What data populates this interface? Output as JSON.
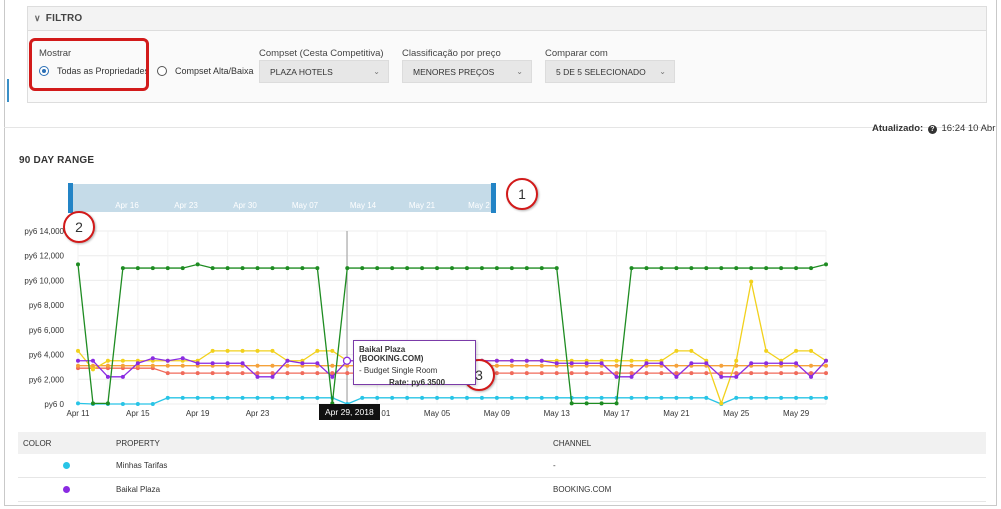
{
  "filter": {
    "title": "FILTRO",
    "show_label": "Mostrar",
    "radio_all": "Todas as Propriedades",
    "radio_compset": "Compset Alta/Baixa",
    "compset_label": "Compset (Cesta Competitiva)",
    "compset_value": "PLAZA HOTELS",
    "price_label": "Classificação por preço",
    "price_value": "MENORES PREÇOS",
    "compare_label": "Comparar com",
    "compare_value": "5 DE 5 SELECIONADO"
  },
  "updated": {
    "label": "Atualizado:",
    "value": "16:24 10 Abr"
  },
  "section_title": "90 DAY RANGE",
  "callouts": [
    "1",
    "2",
    "3"
  ],
  "tooltip": {
    "title": "Baikal Plaza (BOOKING.COM)",
    "room": "- Budget Single Room",
    "rate": "Rate: py6 3500"
  },
  "hover_date": "Apr 29, 2018",
  "colors": {
    "green": "#1e8c22",
    "yellow": "#f2d11c",
    "purple": "#8a2be2",
    "red": "#f06a5a",
    "orange": "#f5a23a",
    "cyan": "#28c4e6",
    "navigator": "#c5dbe8",
    "handle": "#2384c6"
  },
  "chart_data": {
    "type": "line",
    "ylim": [
      0,
      14000
    ],
    "y_ticks": [
      "py6 0",
      "py6 2,000",
      "py6 4,000",
      "py6 6,000",
      "py6 8,000",
      "py6 10,000",
      "py6 12,000",
      "py6 14,000"
    ],
    "x_ticks": [
      "Apr 11",
      "Apr 15",
      "Apr 19",
      "Apr 23",
      "Apr 29",
      "May 01",
      "May 05",
      "May 09",
      "May 13",
      "May 17",
      "May 21",
      "May 25",
      "May 29"
    ],
    "navigator_ticks": [
      "Apr 16",
      "Apr 23",
      "Apr 30",
      "May 07",
      "May 14",
      "May 21",
      "May 2"
    ],
    "x_start": "2018-04-11",
    "num_days": 51,
    "series": [
      {
        "color": "green",
        "values": [
          11300,
          50,
          50,
          11000,
          11000,
          11000,
          11000,
          11000,
          11300,
          11000,
          11000,
          11000,
          11000,
          11000,
          11000,
          11000,
          11000,
          50,
          11000,
          11000,
          11000,
          11000,
          11000,
          11000,
          11000,
          11000,
          11000,
          11000,
          11000,
          11000,
          11000,
          11000,
          11000,
          50,
          50,
          50,
          50,
          11000,
          11000,
          11000,
          11000,
          11000,
          11000,
          11000,
          11000,
          11000,
          11000,
          11000,
          11000,
          11000,
          11300
        ]
      },
      {
        "color": "yellow",
        "values": [
          4300,
          2800,
          3500,
          3500,
          3500,
          3500,
          3500,
          3500,
          3500,
          4300,
          4300,
          4300,
          4300,
          4300,
          3500,
          3500,
          4300,
          4300,
          3500,
          3500,
          3500,
          3500,
          3500,
          3500,
          3500,
          3500,
          3500,
          3500,
          3500,
          3500,
          3500,
          3500,
          3500,
          3500,
          3500,
          3500,
          3500,
          3500,
          3500,
          3500,
          4300,
          4300,
          3500,
          50,
          3500,
          9900,
          4300,
          3500,
          4300,
          4300,
          3500
        ]
      },
      {
        "color": "purple",
        "values": [
          3500,
          3500,
          2200,
          2200,
          3300,
          3700,
          3500,
          3700,
          3300,
          3300,
          3300,
          3300,
          2200,
          2200,
          3500,
          3300,
          3300,
          2200,
          3500,
          3500,
          3500,
          3500,
          3500,
          3500,
          3500,
          3500,
          3500,
          3500,
          3500,
          3500,
          3500,
          3500,
          3300,
          3300,
          3300,
          3300,
          2200,
          2200,
          3300,
          3300,
          2200,
          3300,
          3300,
          2200,
          2200,
          3300,
          3300,
          3300,
          3300,
          2200,
          3500
        ]
      },
      {
        "color": "red",
        "values": [
          2900,
          2900,
          2900,
          2900,
          2900,
          2900,
          2500,
          2500,
          2500,
          2500,
          2500,
          2500,
          2500,
          2500,
          2500,
          2500,
          2500,
          2500,
          2500,
          2500,
          2500,
          2500,
          2500,
          2500,
          2500,
          2500,
          2500,
          2500,
          2500,
          2500,
          2500,
          2500,
          2500,
          2500,
          2500,
          2500,
          2500,
          2500,
          2500,
          2500,
          2500,
          2500,
          2500,
          2500,
          2500,
          2500,
          2500,
          2500,
          2500,
          2500,
          2500
        ]
      },
      {
        "color": "orange",
        "values": [
          3100,
          3100,
          3100,
          3100,
          3100,
          3100,
          3100,
          3100,
          3100,
          3100,
          3100,
          3100,
          3100,
          3100,
          3100,
          3100,
          3100,
          3100,
          3100,
          3100,
          3100,
          3100,
          3100,
          3100,
          3100,
          3100,
          3100,
          3100,
          3100,
          3100,
          3100,
          3100,
          3100,
          3100,
          3100,
          3100,
          3100,
          3100,
          3100,
          3100,
          3100,
          3100,
          3100,
          3100,
          3100,
          3100,
          3100,
          3100,
          3100,
          3100,
          3100
        ]
      },
      {
        "color": "cyan",
        "values": [
          50,
          0,
          0,
          0,
          0,
          0,
          500,
          500,
          500,
          500,
          500,
          500,
          500,
          500,
          500,
          500,
          500,
          500,
          0,
          500,
          500,
          500,
          500,
          500,
          500,
          500,
          500,
          500,
          500,
          500,
          500,
          500,
          500,
          500,
          500,
          500,
          500,
          500,
          500,
          500,
          500,
          500,
          500,
          0,
          500,
          500,
          500,
          500,
          500,
          500,
          500
        ]
      }
    ]
  },
  "table": {
    "headers": [
      "COLOR",
      "PROPERTY",
      "CHANNEL"
    ],
    "rows": [
      {
        "color": "cyan",
        "property": "Minhas Tarifas",
        "channel": "-"
      },
      {
        "color": "purple",
        "property": "Baikal Plaza",
        "channel": "BOOKING.COM"
      }
    ]
  }
}
